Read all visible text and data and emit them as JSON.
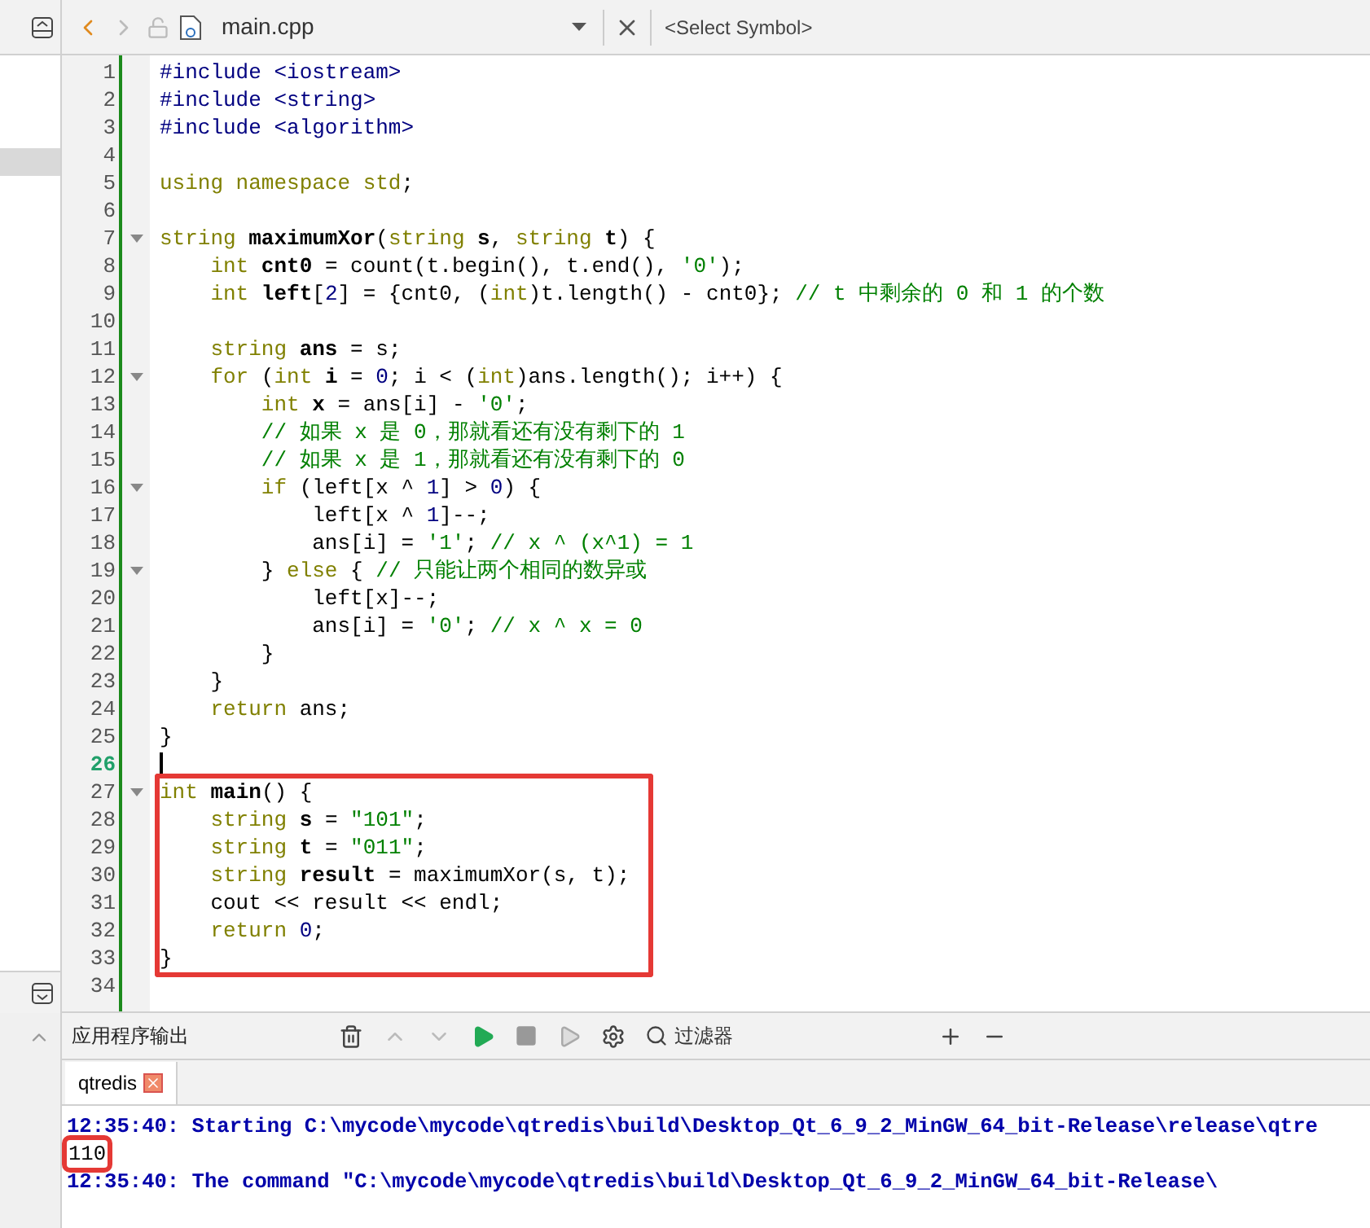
{
  "editor_toolbar": {
    "file_name": "main.cpp",
    "symbol_placeholder": "<Select Symbol>"
  },
  "code_lines": [
    {
      "number": "1",
      "fold": false,
      "current": false,
      "annotated": false,
      "segments": [
        {
          "kind": "pp",
          "text": "#include <iostream>"
        }
      ]
    },
    {
      "number": "2",
      "fold": false,
      "current": false,
      "annotated": false,
      "segments": [
        {
          "kind": "pp",
          "text": "#include <string>"
        }
      ]
    },
    {
      "number": "3",
      "fold": false,
      "current": false,
      "annotated": false,
      "segments": [
        {
          "kind": "pp",
          "text": "#include <algorithm>"
        }
      ]
    },
    {
      "number": "4",
      "fold": false,
      "current": false,
      "annotated": false
    },
    {
      "number": "5",
      "fold": false,
      "current": false,
      "annotated": false,
      "segments": [
        {
          "kind": "kw",
          "text": "using namespace std"
        },
        {
          "kind": "plain",
          "text": ";"
        }
      ]
    },
    {
      "number": "6",
      "fold": false,
      "current": false,
      "annotated": false
    },
    {
      "number": "7",
      "fold": true,
      "current": false,
      "annotated": false,
      "segments": [
        {
          "kind": "kw",
          "text": "string "
        },
        {
          "kind": "decl",
          "text": "maximumXor"
        },
        {
          "kind": "plain",
          "text": "("
        },
        {
          "kind": "kw",
          "text": "string "
        },
        {
          "kind": "decl",
          "text": "s"
        },
        {
          "kind": "plain",
          "text": ", "
        },
        {
          "kind": "kw",
          "text": "string "
        },
        {
          "kind": "decl",
          "text": "t"
        },
        {
          "kind": "plain",
          "text": ") {"
        }
      ]
    },
    {
      "number": "8",
      "fold": false,
      "current": false,
      "annotated": false,
      "segments": [
        {
          "kind": "kw",
          "text": "    int "
        },
        {
          "kind": "decl",
          "text": "cnt0"
        },
        {
          "kind": "plain",
          "text": " = count(t.begin(), t.end(), "
        },
        {
          "kind": "str",
          "text": "'0'"
        },
        {
          "kind": "plain",
          "text": ");"
        }
      ]
    },
    {
      "number": "9",
      "fold": false,
      "current": false,
      "annotated": false,
      "segments": [
        {
          "kind": "kw",
          "text": "    int "
        },
        {
          "kind": "decl",
          "text": "left"
        },
        {
          "kind": "plain",
          "text": "["
        },
        {
          "kind": "num",
          "text": "2"
        },
        {
          "kind": "plain",
          "text": "] = {cnt0, ("
        },
        {
          "kind": "kw",
          "text": "int"
        },
        {
          "kind": "plain",
          "text": ")t.length() - cnt0}; "
        },
        {
          "kind": "cm",
          "text": "// t 中剩余的 0 和 1 的个数"
        }
      ]
    },
    {
      "number": "10",
      "fold": false,
      "current": false,
      "annotated": false
    },
    {
      "number": "11",
      "fold": false,
      "current": false,
      "annotated": false,
      "segments": [
        {
          "kind": "kw",
          "text": "    string "
        },
        {
          "kind": "decl",
          "text": "ans"
        },
        {
          "kind": "plain",
          "text": " = s;"
        }
      ]
    },
    {
      "number": "12",
      "fold": true,
      "current": false,
      "annotated": false,
      "segments": [
        {
          "kind": "kw",
          "text": "    for"
        },
        {
          "kind": "plain",
          "text": " ("
        },
        {
          "kind": "kw",
          "text": "int "
        },
        {
          "kind": "decl",
          "text": "i"
        },
        {
          "kind": "plain",
          "text": " = "
        },
        {
          "kind": "num",
          "text": "0"
        },
        {
          "kind": "plain",
          "text": "; i < ("
        },
        {
          "kind": "kw",
          "text": "int"
        },
        {
          "kind": "plain",
          "text": ")ans.length(); i++) {"
        }
      ]
    },
    {
      "number": "13",
      "fold": false,
      "current": false,
      "annotated": false,
      "segments": [
        {
          "kind": "kw",
          "text": "        int "
        },
        {
          "kind": "decl",
          "text": "x"
        },
        {
          "kind": "plain",
          "text": " = ans[i] - "
        },
        {
          "kind": "str",
          "text": "'0'"
        },
        {
          "kind": "plain",
          "text": ";"
        }
      ]
    },
    {
      "number": "14",
      "fold": false,
      "current": false,
      "annotated": false,
      "segments": [
        {
          "kind": "cm",
          "text": "        // 如果 x 是 0，那就看还有没有剩下的 1"
        }
      ]
    },
    {
      "number": "15",
      "fold": false,
      "current": false,
      "annotated": false,
      "segments": [
        {
          "kind": "cm",
          "text": "        // 如果 x 是 1，那就看还有没有剩下的 0"
        }
      ]
    },
    {
      "number": "16",
      "fold": true,
      "current": false,
      "annotated": false,
      "segments": [
        {
          "kind": "kw",
          "text": "        if"
        },
        {
          "kind": "plain",
          "text": " (left[x ^ "
        },
        {
          "kind": "num",
          "text": "1"
        },
        {
          "kind": "plain",
          "text": "] > "
        },
        {
          "kind": "num",
          "text": "0"
        },
        {
          "kind": "plain",
          "text": ") {"
        }
      ]
    },
    {
      "number": "17",
      "fold": false,
      "current": false,
      "annotated": false,
      "segments": [
        {
          "kind": "plain",
          "text": "            left[x ^ "
        },
        {
          "kind": "num",
          "text": "1"
        },
        {
          "kind": "plain",
          "text": "]--;"
        }
      ]
    },
    {
      "number": "18",
      "fold": false,
      "current": false,
      "annotated": false,
      "segments": [
        {
          "kind": "plain",
          "text": "            ans[i] = "
        },
        {
          "kind": "str",
          "text": "'1'"
        },
        {
          "kind": "plain",
          "text": "; "
        },
        {
          "kind": "cm",
          "text": "// x ^ (x^1) = 1"
        }
      ]
    },
    {
      "number": "19",
      "fold": true,
      "current": false,
      "annotated": false,
      "segments": [
        {
          "kind": "plain",
          "text": "        } "
        },
        {
          "kind": "kw",
          "text": "else"
        },
        {
          "kind": "plain",
          "text": " { "
        },
        {
          "kind": "cm",
          "text": "// 只能让两个相同的数异或"
        }
      ]
    },
    {
      "number": "20",
      "fold": false,
      "current": false,
      "annotated": false,
      "segments": [
        {
          "kind": "plain",
          "text": "            left[x]--;"
        }
      ]
    },
    {
      "number": "21",
      "fold": false,
      "current": false,
      "annotated": false,
      "segments": [
        {
          "kind": "plain",
          "text": "            ans[i] = "
        },
        {
          "kind": "str",
          "text": "'0'"
        },
        {
          "kind": "plain",
          "text": "; "
        },
        {
          "kind": "cm",
          "text": "// x ^ x = 0"
        }
      ]
    },
    {
      "number": "22",
      "fold": false,
      "current": false,
      "annotated": false,
      "segments": [
        {
          "kind": "plain",
          "text": "        }"
        }
      ]
    },
    {
      "number": "23",
      "fold": false,
      "current": false,
      "annotated": false,
      "segments": [
        {
          "kind": "plain",
          "text": "    }"
        }
      ]
    },
    {
      "number": "24",
      "fold": false,
      "current": false,
      "annotated": false,
      "segments": [
        {
          "kind": "kw",
          "text": "    return"
        },
        {
          "kind": "plain",
          "text": " ans;"
        }
      ]
    },
    {
      "number": "25",
      "fold": false,
      "current": false,
      "annotated": false,
      "segments": [
        {
          "kind": "plain",
          "text": "}"
        }
      ]
    },
    {
      "number": "26",
      "fold": false,
      "current": true,
      "annotated": false
    },
    {
      "number": "27",
      "fold": true,
      "current": false,
      "annotated": true,
      "segments": [
        {
          "kind": "kw",
          "text": "int "
        },
        {
          "kind": "decl",
          "text": "main"
        },
        {
          "kind": "plain",
          "text": "() {"
        }
      ]
    },
    {
      "number": "28",
      "fold": false,
      "current": false,
      "annotated": true,
      "segments": [
        {
          "kind": "kw",
          "text": "    string "
        },
        {
          "kind": "decl",
          "text": "s"
        },
        {
          "kind": "plain",
          "text": " = "
        },
        {
          "kind": "str",
          "text": "\"101\""
        },
        {
          "kind": "plain",
          "text": ";"
        }
      ]
    },
    {
      "number": "29",
      "fold": false,
      "current": false,
      "annotated": true,
      "segments": [
        {
          "kind": "kw",
          "text": "    string "
        },
        {
          "kind": "decl",
          "text": "t"
        },
        {
          "kind": "plain",
          "text": " = "
        },
        {
          "kind": "str",
          "text": "\"011\""
        },
        {
          "kind": "plain",
          "text": ";"
        }
      ]
    },
    {
      "number": "30",
      "fold": false,
      "current": false,
      "annotated": true,
      "segments": [
        {
          "kind": "kw",
          "text": "    string "
        },
        {
          "kind": "decl",
          "text": "result"
        },
        {
          "kind": "plain",
          "text": " = maximumXor(s, t);"
        }
      ]
    },
    {
      "number": "31",
      "fold": false,
      "current": false,
      "annotated": true,
      "segments": [
        {
          "kind": "plain",
          "text": "    cout << result << endl;"
        }
      ]
    },
    {
      "number": "32",
      "fold": false,
      "current": false,
      "annotated": true,
      "segments": [
        {
          "kind": "kw",
          "text": "    return "
        },
        {
          "kind": "num",
          "text": "0"
        },
        {
          "kind": "plain",
          "text": ";"
        }
      ]
    },
    {
      "number": "33",
      "fold": false,
      "current": false,
      "annotated": true,
      "segments": [
        {
          "kind": "plain",
          "text": "}"
        }
      ]
    },
    {
      "number": "34",
      "fold": false,
      "current": false,
      "annotated": false
    }
  ],
  "output_pane": {
    "title": "应用程序输出",
    "filter_placeholder": "过滤器",
    "tabs": [
      {
        "label": "qtredis",
        "selected": true
      }
    ],
    "lines": [
      {
        "kind": "message",
        "annotated": false,
        "text": "12:35:40: Starting C:\\mycode\\mycode\\qtredis\\build\\Desktop_Qt_6_9_2_MinGW_64_bit-Release\\release\\qtre"
      },
      {
        "kind": "program",
        "annotated": true,
        "text": "110"
      },
      {
        "kind": "message",
        "annotated": false,
        "text": "12:35:40: The command \"C:\\mycode\\mycode\\qtredis\\build\\Desktop_Qt_6_9_2_MinGW_64_bit-Release\\"
      }
    ]
  }
}
